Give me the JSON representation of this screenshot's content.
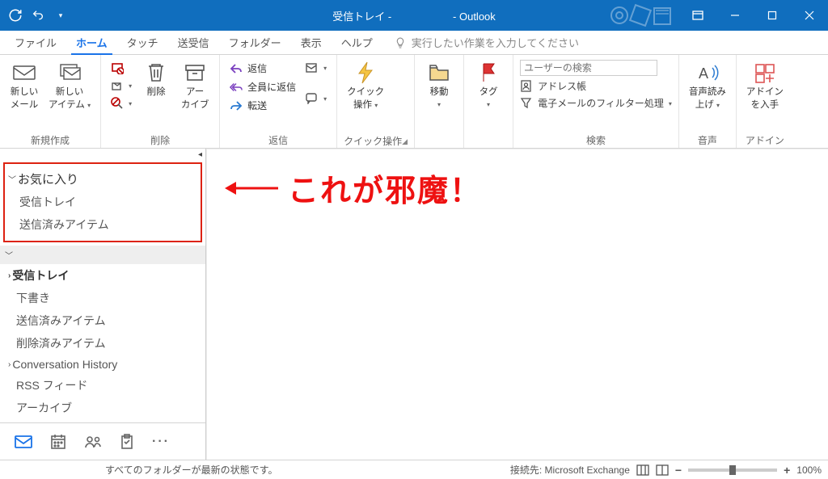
{
  "title": {
    "left": "受信トレイ -",
    "right": "- Outlook"
  },
  "menu": {
    "file": "ファイル",
    "home": "ホーム",
    "touch": "タッチ",
    "sendrecv": "送受信",
    "folder": "フォルダー",
    "view": "表示",
    "help": "ヘルプ",
    "tellme": "実行したい作業を入力してください"
  },
  "ribbon": {
    "group_new": "新規作成",
    "new_mail_l1": "新しい",
    "new_mail_l2": "メール",
    "new_item_l1": "新しい",
    "new_item_l2": "アイテム",
    "group_delete": "削除",
    "delete": "削除",
    "archive_l1": "アー",
    "archive_l2": "カイブ",
    "group_reply": "返信",
    "reply": "返信",
    "reply_all": "全員に返信",
    "forward": "転送",
    "group_quick": "クイック操作",
    "quick_l1": "クイック",
    "quick_l2": "操作",
    "group_move": "",
    "move": "移動",
    "group_tag": "",
    "tag": "タグ",
    "group_find": "検索",
    "search_placeholder": "ユーザーの検索",
    "addressbook": "アドレス帳",
    "filter": "電子メールのフィルター処理",
    "group_speech": "音声",
    "speech_l1": "音声読み",
    "speech_l2": "上げ",
    "group_addin": "アドイン",
    "addin_l1": "アドイン",
    "addin_l2": "を入手"
  },
  "nav": {
    "favorites": "お気に入り",
    "fav_inbox": "受信トレイ",
    "fav_sent": "送信済みアイテム",
    "inbox": "受信トレイ",
    "drafts": "下書き",
    "sent": "送信済みアイテム",
    "deleted": "削除済みアイテム",
    "conv": "Conversation History",
    "rss": "RSS フィード",
    "archive": "アーカイブ"
  },
  "annotation": "これが邪魔！",
  "status": {
    "left": "すべてのフォルダーが最新の状態です。",
    "conn": "接続先: Microsoft Exchange",
    "zoom": "100%"
  }
}
